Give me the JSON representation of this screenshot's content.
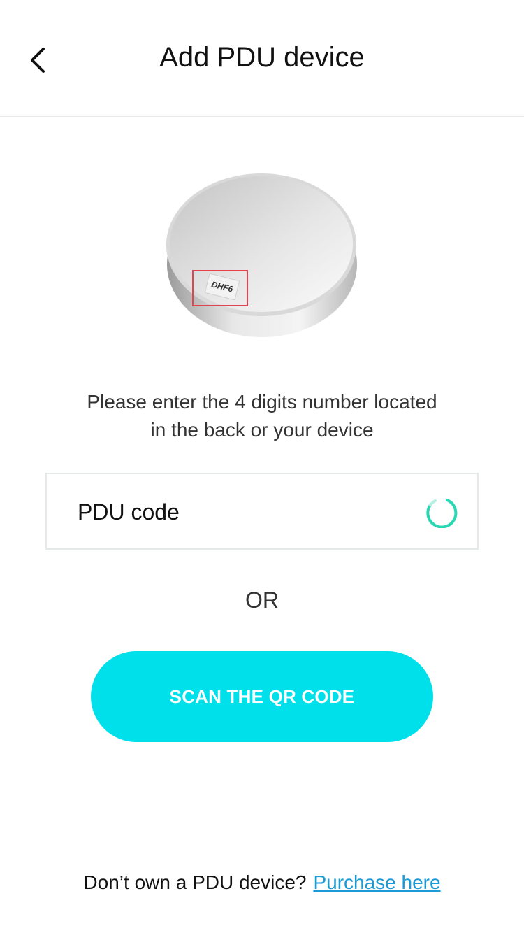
{
  "header": {
    "title": "Add PDU device",
    "back_icon": "chevron-left-icon"
  },
  "illustration": {
    "sticker_code": "DHF6",
    "highlight_color": "#e5434b"
  },
  "instruction": {
    "line1": "Please enter the 4 digits number located",
    "line2": "in the back or your device"
  },
  "code_field": {
    "placeholder": "PDU code",
    "value": "",
    "loading_icon": "spinner-icon",
    "spinner_color": "#2ad7b3"
  },
  "divider_text": "OR",
  "scan_button": {
    "label": "SCAN THE QR CODE",
    "color": "#00e0ea"
  },
  "footer": {
    "prompt": "Don’t own a PDU device?",
    "link_label": "Purchase here",
    "link_color": "#1a9ad6"
  }
}
